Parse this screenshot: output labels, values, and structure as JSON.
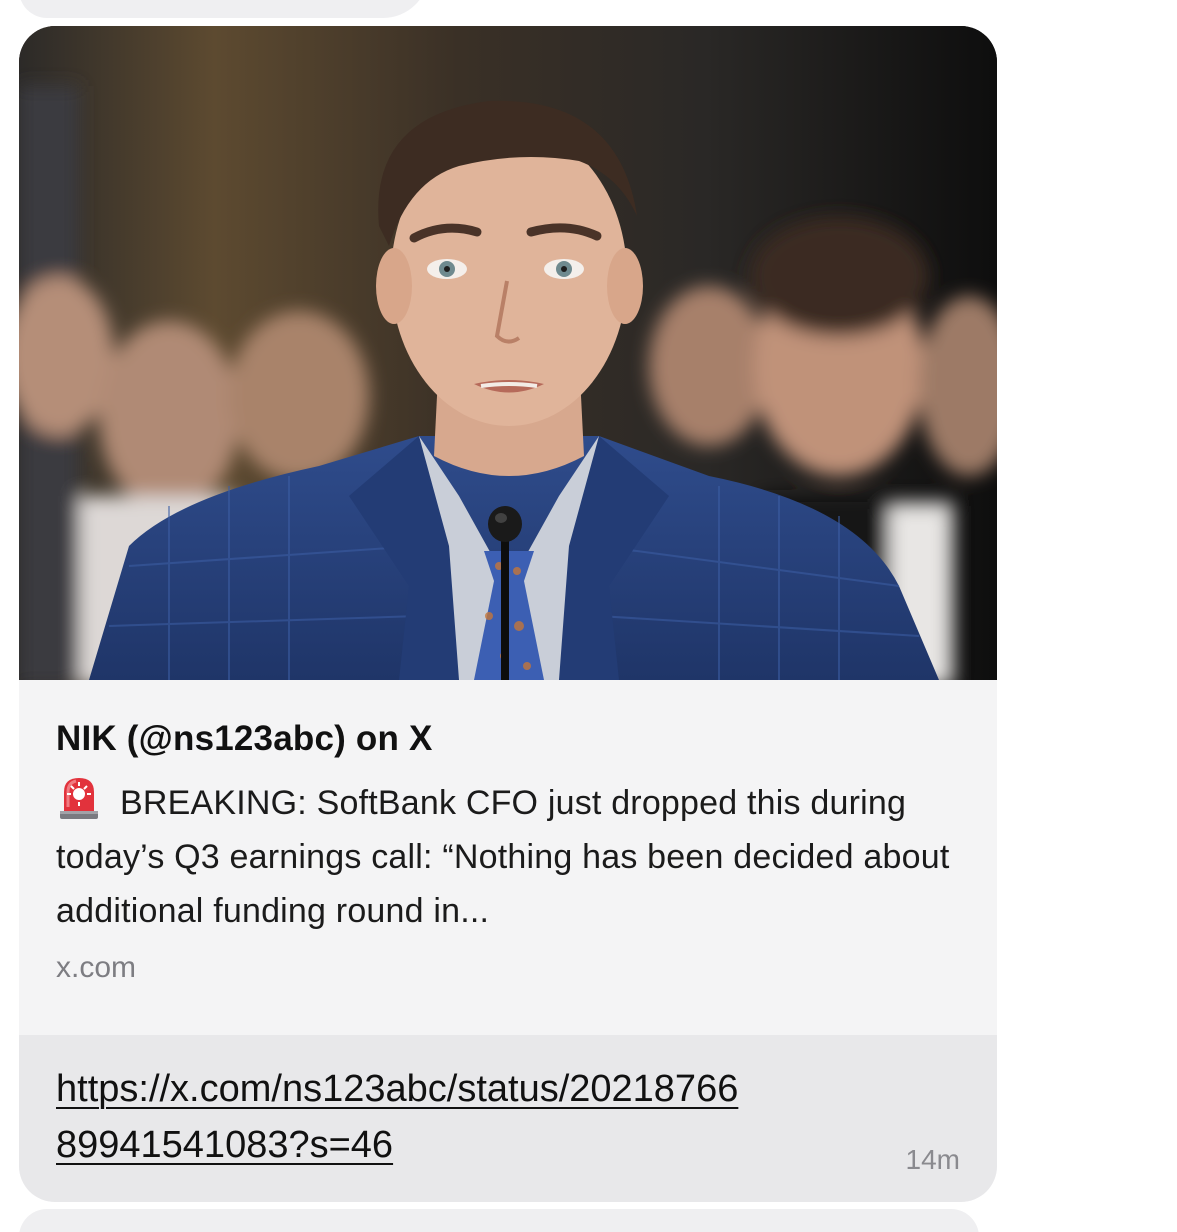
{
  "preview": {
    "image_subject": "photo of man in blue suit speaking at microphone",
    "title": "NIK (@ns123abc) on X",
    "description_icon": "police-siren-icon",
    "description": "BREAKING: SoftBank CFO just dropped this during today’s Q3 earnings call: “Nothing has been decided about additional funding round in...",
    "domain": "x.com"
  },
  "message": {
    "url": "https://x.com/ns123abc/status/2021876689941541083?s=46",
    "timestamp": "14m"
  },
  "colors": {
    "card_bg": "#f4f4f5",
    "url_bg": "#e8e8ea",
    "bubble_bg": "#efeff1",
    "suit_blue": "#27427f",
    "siren_red": "#e2323c"
  }
}
